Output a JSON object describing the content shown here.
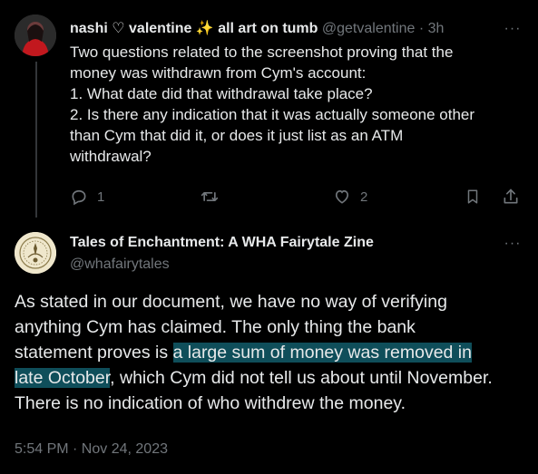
{
  "reply_tweet": {
    "author_name": "nashi ♡ valentine ✨ all art on tumb",
    "handle": "@getvalentine",
    "separator": "·",
    "time_ago": "3h",
    "more": "···",
    "body_lines": [
      "Two questions related to the screenshot proving that the",
      "money was withdrawn from Cym's account:",
      "1. What date did that withdrawal take place?",
      "2. Is there any indication that it was actually someone other",
      "than Cym that did it, or does it just list as an ATM",
      "withdrawal?"
    ],
    "actions": {
      "reply_count": "1",
      "retweet_count": "",
      "like_count": "2",
      "icons": [
        "reply-icon",
        "retweet-icon",
        "like-icon",
        "bookmark-icon",
        "share-icon"
      ]
    }
  },
  "main_tweet": {
    "author_name": "Tales of Enchantment: A WHA Fairytale Zine",
    "handle": "@whafairytales",
    "more": "···",
    "body": {
      "line1": "As stated in our document, we have no way of verifying",
      "line2": "anything Cym has claimed. The only thing the bank",
      "line3_pre": "statement proves is ",
      "line3_hl": "a large sum of money was removed in",
      "line4_hl": "late October",
      "line4_post": ", which Cym did not tell us about until November.",
      "line5": "There is no indication of who withdrew the money."
    },
    "timestamp": "5:54 PM · Nov 24, 2023"
  },
  "colors": {
    "background": "#000000",
    "text": "#e7e9ea",
    "muted": "#71767b",
    "highlight": "#0f4e5a",
    "thread_line": "#333639"
  }
}
